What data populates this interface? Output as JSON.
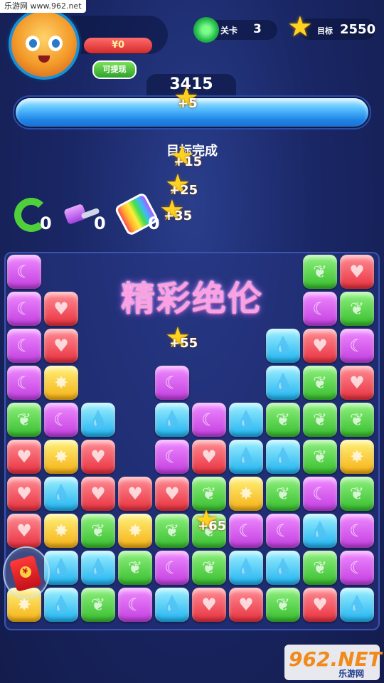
{
  "watermark": "乐游网 www.962.net",
  "header": {
    "money": "¥0",
    "withdraw_label": "可提现",
    "level_label": "关卡",
    "level_value": "3",
    "goal_label": "目标",
    "goal_value": "2550"
  },
  "progress": {
    "score_text": "3415",
    "fraction": 1.0,
    "status_text": "目标完成"
  },
  "tools": [
    {
      "icon": "refresh-icon",
      "count": "0"
    },
    {
      "icon": "hammer-icon",
      "count": "0"
    },
    {
      "icon": "rainbow-icon",
      "count": "0"
    }
  ],
  "combo_text": "精彩绝伦",
  "score_pops": [
    "+5",
    "+15",
    "+25",
    "+35",
    "+55",
    "+65"
  ],
  "colors": {
    "purple": "#d653ea",
    "red": "#ee4550",
    "green": "#4fcf3a",
    "blue": "#2fbdf3",
    "yellow": "#f8c424"
  },
  "board": {
    "rows": [
      [
        "purple",
        "",
        "",
        "",
        "",
        "",
        "",
        "",
        "green",
        "red"
      ],
      [
        "purple",
        "red",
        "",
        "",
        "",
        "",
        "",
        "",
        "purple",
        "green"
      ],
      [
        "purple",
        "red",
        "",
        "",
        "",
        "",
        "",
        "blue",
        "red",
        "purple"
      ],
      [
        "purple",
        "yellow",
        "",
        "",
        "purple",
        "",
        "",
        "blue",
        "green",
        "red"
      ],
      [
        "green",
        "purple",
        "blue",
        "",
        "blue",
        "purple",
        "blue",
        "green",
        "green",
        "green"
      ],
      [
        "red",
        "yellow",
        "red",
        "",
        "purple",
        "red",
        "blue",
        "blue",
        "green",
        "yellow"
      ],
      [
        "red",
        "blue",
        "red",
        "red",
        "red",
        "green",
        "yellow",
        "green",
        "purple",
        "green"
      ],
      [
        "red",
        "yellow",
        "green",
        "yellow",
        "green",
        "green",
        "purple",
        "purple",
        "blue",
        "purple"
      ],
      [
        "",
        "blue",
        "blue",
        "green",
        "purple",
        "green",
        "blue",
        "blue",
        "green",
        "purple"
      ],
      [
        "yellow",
        "blue",
        "green",
        "purple",
        "blue",
        "red",
        "red",
        "green",
        "red",
        "blue"
      ]
    ],
    "symbols": {
      "purple": "☾",
      "red": "♥",
      "green": "❦",
      "blue": "💧",
      "yellow": "✸"
    }
  },
  "logo": {
    "main": "962.NET",
    "sub": "乐游网"
  }
}
